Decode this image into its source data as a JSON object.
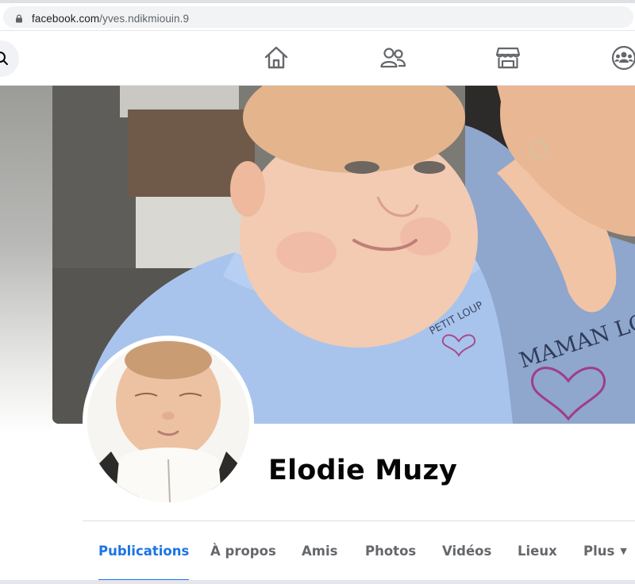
{
  "browser": {
    "url_host": "facebook.com",
    "url_path": "/yves.ndikmiouin.9"
  },
  "nav": {
    "icons": [
      "search-icon",
      "home-icon",
      "friends-icon",
      "marketplace-icon",
      "groups-icon"
    ]
  },
  "profile": {
    "name": "Elodie Muzy",
    "cover_shirt_text_1": "PETIT LOUP",
    "cover_shirt_text_2": "MAMAN LOUVE"
  },
  "tabs": [
    {
      "label": "Publications",
      "active": true
    },
    {
      "label": "À propos"
    },
    {
      "label": "Amis"
    },
    {
      "label": "Photos"
    },
    {
      "label": "Vidéos"
    },
    {
      "label": "Lieux"
    },
    {
      "label": "Plus"
    }
  ],
  "colors": {
    "accent": "#1b74e4",
    "tab_text": "#65676b",
    "name_text": "#050505"
  }
}
